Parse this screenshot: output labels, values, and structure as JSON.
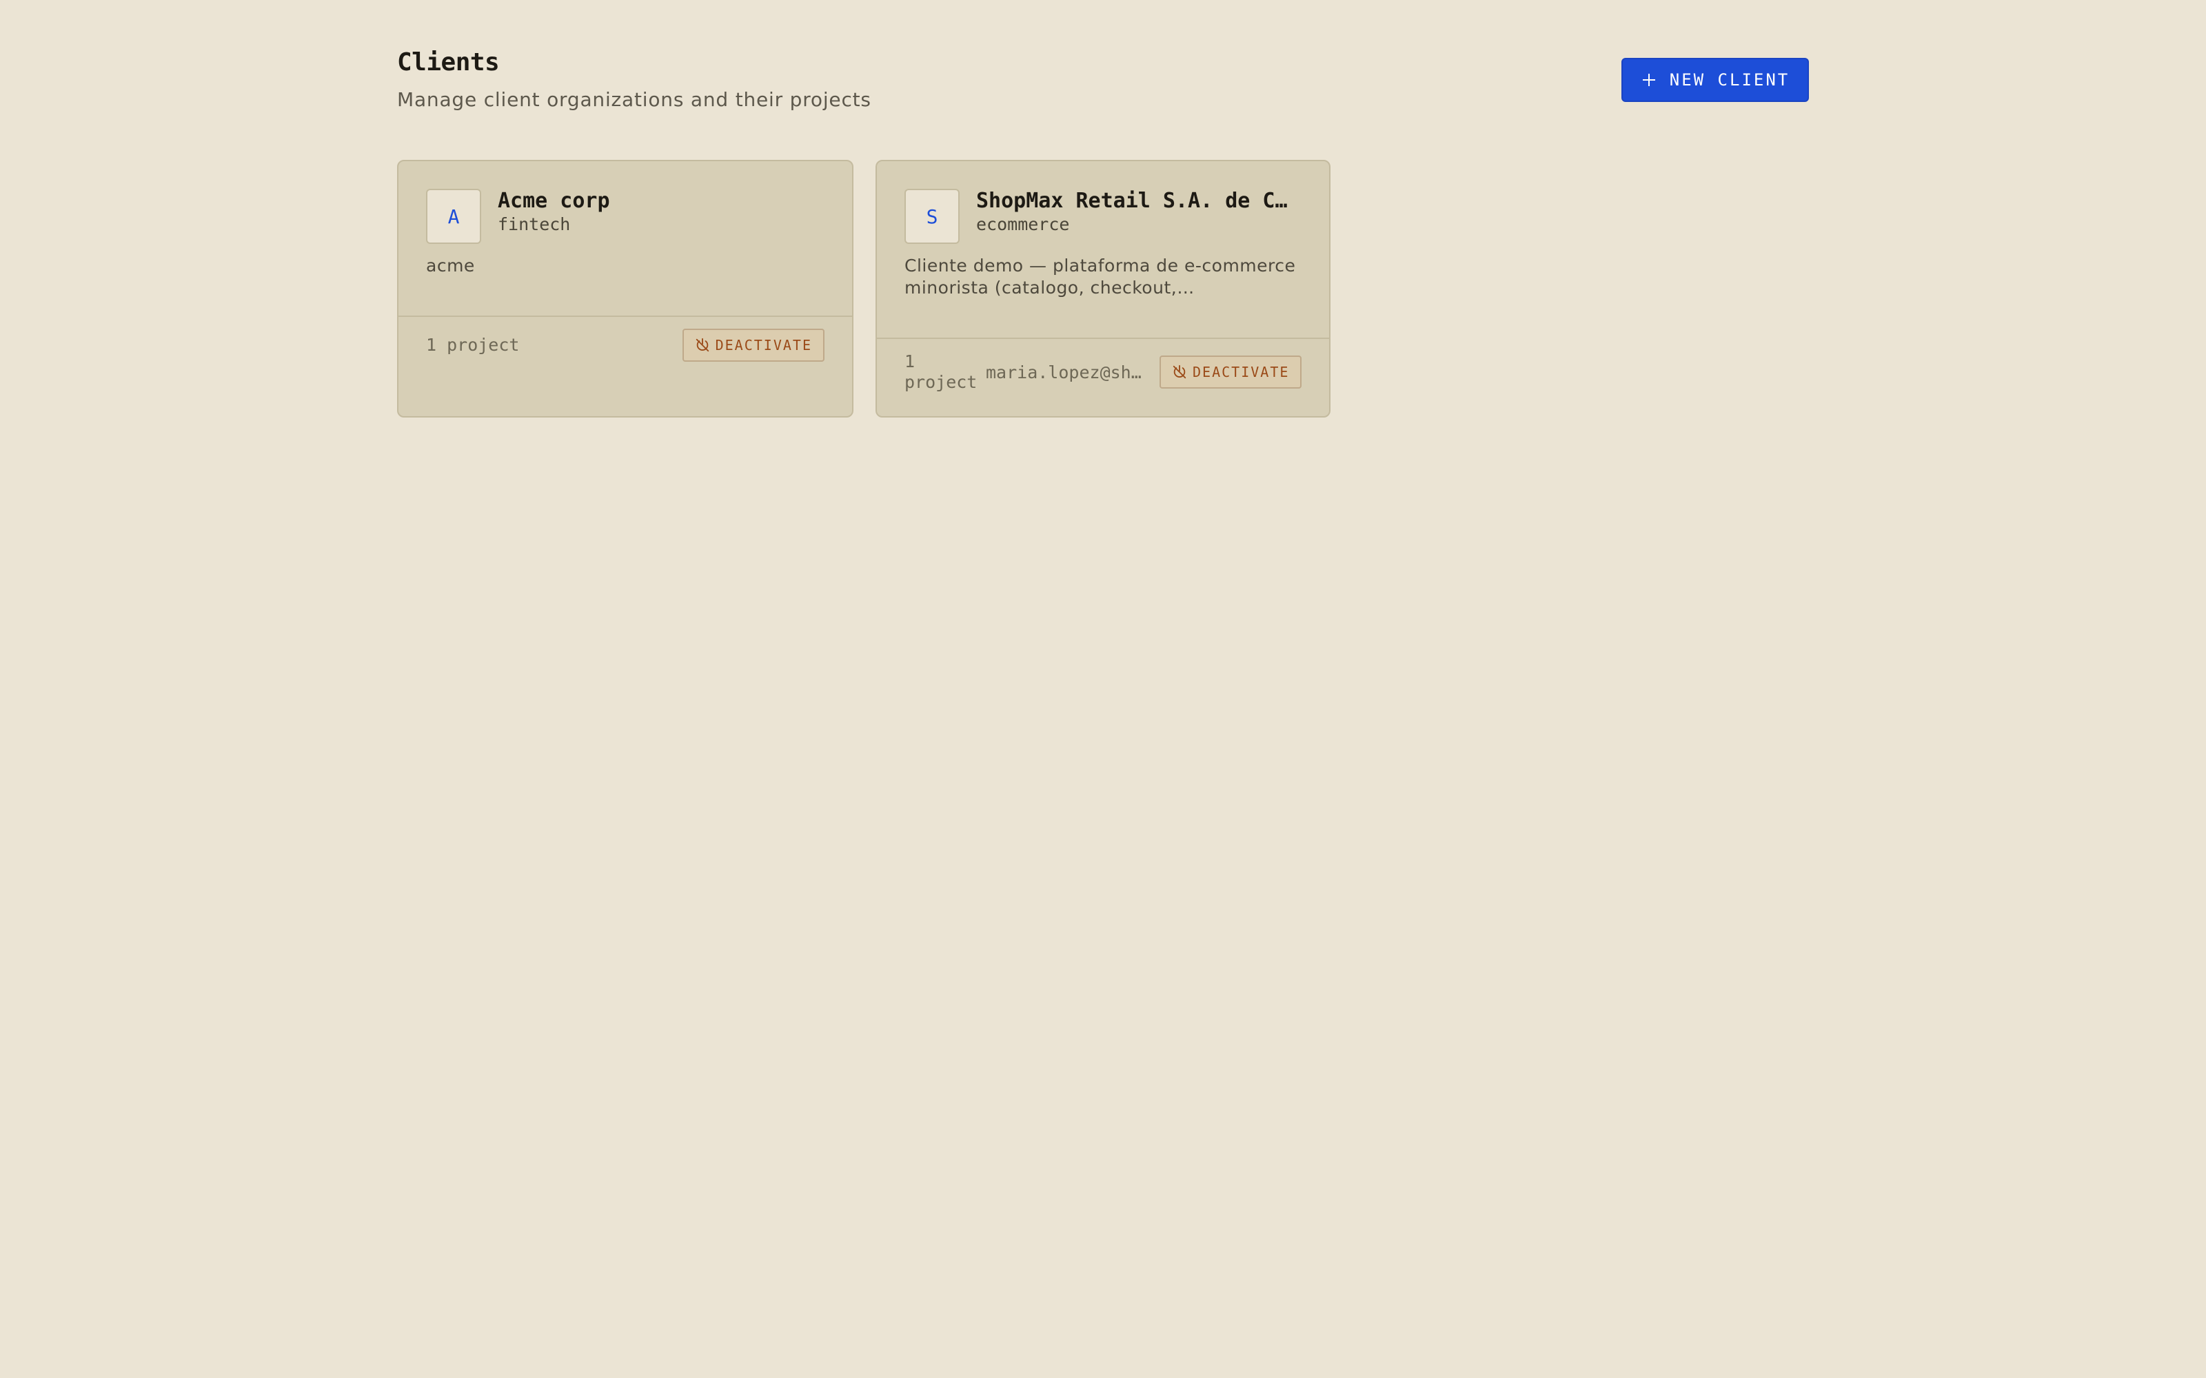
{
  "header": {
    "title": "Clients",
    "subtitle": "Manage client organizations and their projects"
  },
  "toolbar": {
    "new_client_label": "NEW CLIENT",
    "new_client_icon": "plus-icon"
  },
  "clients": [
    {
      "avatar_letter": "A",
      "name": "Acme corp",
      "industry": "fintech",
      "description": "acme",
      "project_count": "1 project",
      "contact_email": "",
      "deactivate_label": "DEACTIVATE"
    },
    {
      "avatar_letter": "S",
      "name": "ShopMax Retail S.A. de C…",
      "industry": "ecommerce",
      "description": "Cliente demo — plataforma de e-commerce minorista (catalogo, checkout,…",
      "project_count": "1 project",
      "contact_email": "maria.lopez@sh…",
      "deactivate_label": "DEACTIVATE"
    }
  ],
  "colors": {
    "background": "#ebe4d4",
    "card": "#d7cfb6",
    "accent": "#1d4ed8",
    "danger": "#9a4a18"
  }
}
